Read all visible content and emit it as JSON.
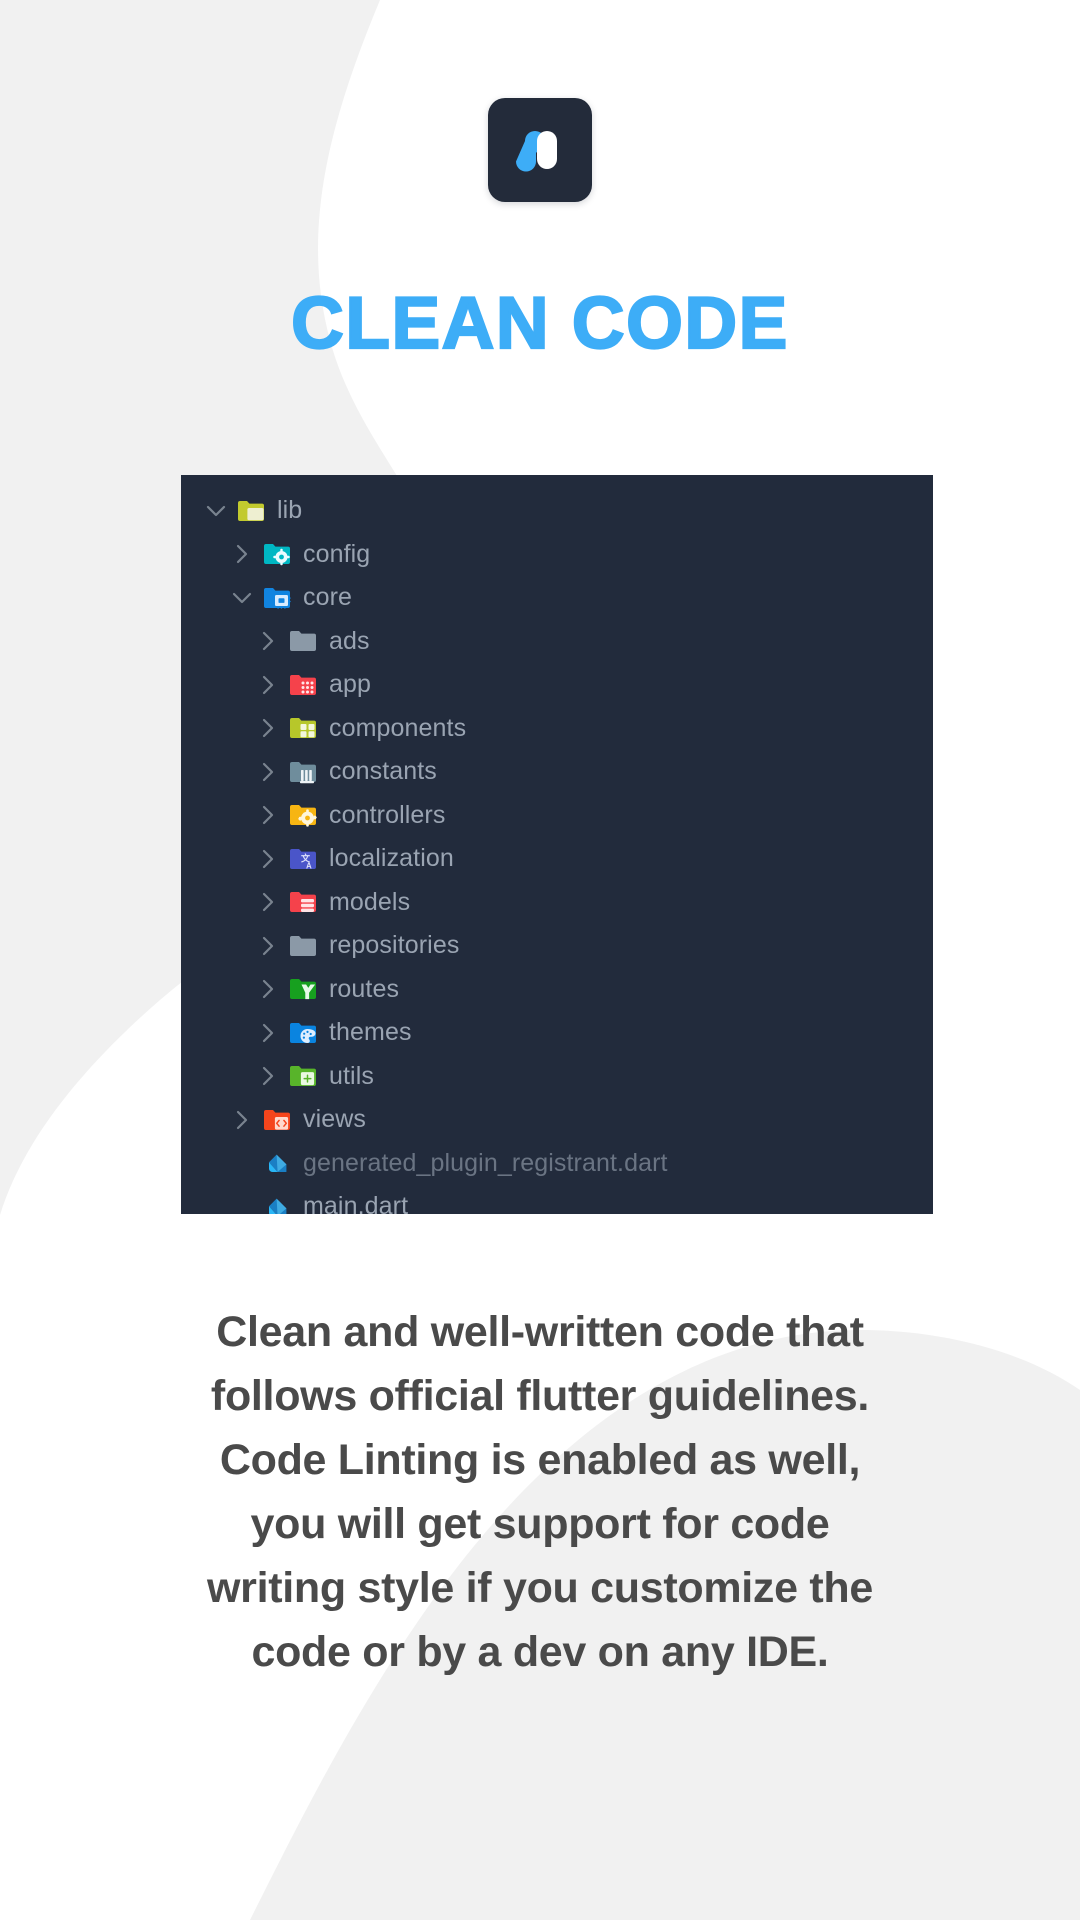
{
  "brand": {
    "logo_icon": "nucleus-n-logo-icon",
    "logo_tile_color": "#232b3a",
    "logo_accent_color": "#3dadf7"
  },
  "header": {
    "title": "CLEAN CODE",
    "title_color": "#3dadf7"
  },
  "file_tree": {
    "panel_background": "#222b3c",
    "items": [
      {
        "label": "lib",
        "depth": 0,
        "chevron": "chevron-down-icon",
        "icon": "folder-lib-icon",
        "icon_color": "#c2ca2e",
        "dim": false
      },
      {
        "label": "config",
        "depth": 1,
        "chevron": "chevron-right-icon",
        "icon": "folder-config-icon",
        "icon_color": "#00b7c3",
        "dim": false
      },
      {
        "label": "core",
        "depth": 1,
        "chevron": "chevron-down-icon",
        "icon": "folder-core-icon",
        "icon_color": "#1184e0",
        "dim": false
      },
      {
        "label": "ads",
        "depth": 2,
        "chevron": "chevron-right-icon",
        "icon": "folder-plain-icon",
        "icon_color": "#8b99a7",
        "dim": false
      },
      {
        "label": "app",
        "depth": 2,
        "chevron": "chevron-right-icon",
        "icon": "folder-app-icon",
        "icon_color": "#f5424b",
        "dim": false
      },
      {
        "label": "components",
        "depth": 2,
        "chevron": "chevron-right-icon",
        "icon": "folder-components-icon",
        "icon_color": "#b7c72a",
        "dim": false
      },
      {
        "label": "constants",
        "depth": 2,
        "chevron": "chevron-right-icon",
        "icon": "folder-constants-icon",
        "icon_color": "#6f8d9c",
        "dim": false
      },
      {
        "label": "controllers",
        "depth": 2,
        "chevron": "chevron-right-icon",
        "icon": "folder-controllers-icon",
        "icon_color": "#f7b512",
        "dim": false
      },
      {
        "label": "localization",
        "depth": 2,
        "chevron": "chevron-right-icon",
        "icon": "folder-localization-icon",
        "icon_color": "#4a55c9",
        "dim": false
      },
      {
        "label": "models",
        "depth": 2,
        "chevron": "chevron-right-icon",
        "icon": "folder-models-icon",
        "icon_color": "#f5424b",
        "dim": false
      },
      {
        "label": "repositories",
        "depth": 2,
        "chevron": "chevron-right-icon",
        "icon": "folder-plain-icon",
        "icon_color": "#8b99a7",
        "dim": false
      },
      {
        "label": "routes",
        "depth": 2,
        "chevron": "chevron-right-icon",
        "icon": "folder-routes-icon",
        "icon_color": "#17a01f",
        "dim": false
      },
      {
        "label": "themes",
        "depth": 2,
        "chevron": "chevron-right-icon",
        "icon": "folder-themes-icon",
        "icon_color": "#0a84e0",
        "dim": false
      },
      {
        "label": "utils",
        "depth": 2,
        "chevron": "chevron-right-icon",
        "icon": "folder-utils-icon",
        "icon_color": "#58b42a",
        "dim": false
      },
      {
        "label": "views",
        "depth": 1,
        "chevron": "chevron-right-icon",
        "icon": "folder-views-icon",
        "icon_color": "#f5451c",
        "dim": false
      },
      {
        "label": "generated_plugin_registrant.dart",
        "depth": 1,
        "chevron": "none",
        "icon": "dart-file-icon",
        "icon_color": "#29b6f6",
        "dim": true
      },
      {
        "label": "main.dart",
        "depth": 1,
        "chevron": "none",
        "icon": "dart-file-icon",
        "icon_color": "#29b6f6",
        "dim": false
      }
    ]
  },
  "description": {
    "lines": [
      "Clean and well-written code that",
      "follows official flutter guidelines.",
      "Code Linting is enabled as well,",
      "you will get support for code",
      "writing style if you customize the",
      "code or by a dev on any IDE."
    ],
    "text_color": "#4a4a4a"
  },
  "decoration": {
    "blob_color": "#f1f1f1"
  }
}
